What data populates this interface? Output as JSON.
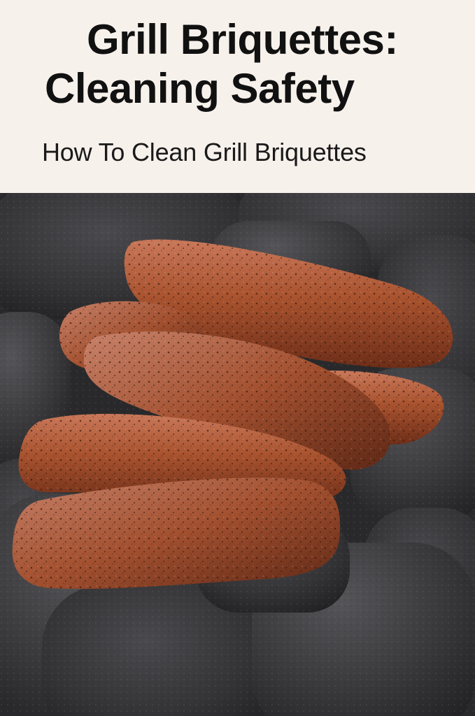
{
  "header": {
    "title_line1": "Grill Briquettes:",
    "title_line2": "Cleaning Safety",
    "subtitle": "How To Clean Grill Briquettes"
  },
  "colors": {
    "background": "#f7f1ec",
    "title": "#111111",
    "briquette_dark": "#38383b",
    "briquette_rust": "#a9532f"
  },
  "image": {
    "subject": "rust-coated grill briquettes resting on dark charcoal briquettes"
  }
}
